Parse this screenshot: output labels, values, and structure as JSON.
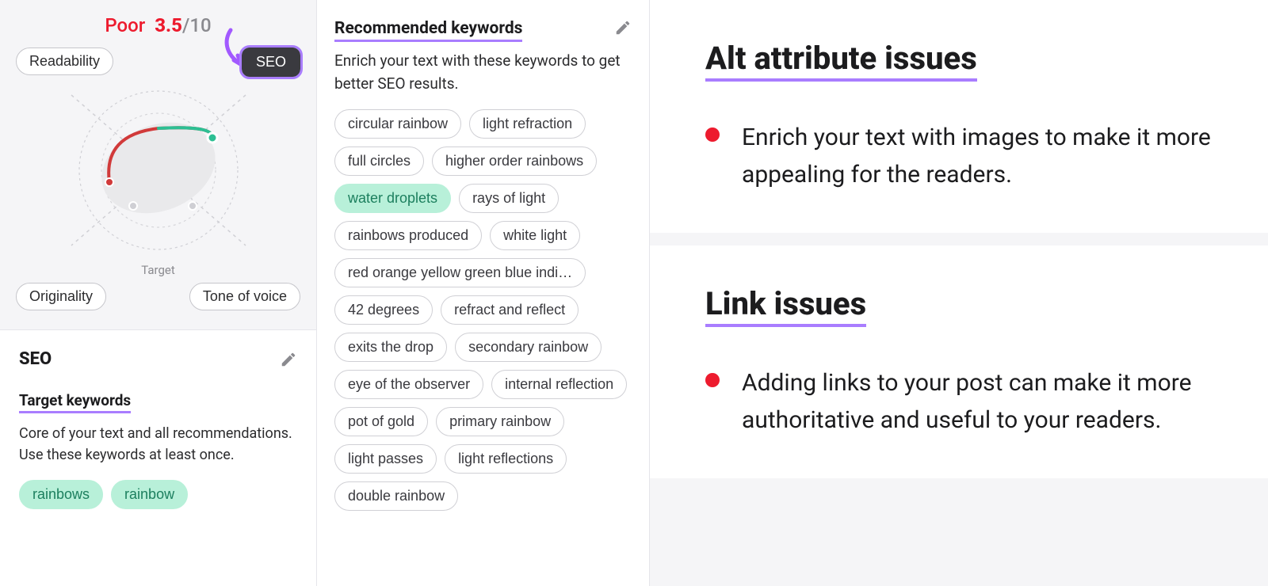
{
  "score": {
    "label": "Poor",
    "value": "3.5",
    "out_of": "/10"
  },
  "axes": {
    "readability": "Readability",
    "seo": "SEO",
    "originality": "Originality",
    "tone": "Tone of voice",
    "target_label": "Target"
  },
  "seo_card": {
    "title": "SEO",
    "section_title": "Target keywords",
    "desc": "Core of your text and all recommendations. Use these keywords at least once.",
    "keywords": [
      "rainbows",
      "rainbow"
    ]
  },
  "recommended": {
    "title": "Recommended keywords",
    "desc": "Enrich your text with these keywords to get better SEO results.",
    "keywords": [
      {
        "text": "circular rainbow",
        "hl": false
      },
      {
        "text": "light refraction",
        "hl": false
      },
      {
        "text": "full circles",
        "hl": false
      },
      {
        "text": "higher order rainbows",
        "hl": false
      },
      {
        "text": "water droplets",
        "hl": true
      },
      {
        "text": "rays of light",
        "hl": false
      },
      {
        "text": "rainbows produced",
        "hl": false
      },
      {
        "text": "white light",
        "hl": false
      },
      {
        "text": "red orange yellow green blue indi…",
        "hl": false
      },
      {
        "text": "42 degrees",
        "hl": false
      },
      {
        "text": "refract and reflect",
        "hl": false
      },
      {
        "text": "exits the drop",
        "hl": false
      },
      {
        "text": "secondary rainbow",
        "hl": false
      },
      {
        "text": "eye of the observer",
        "hl": false
      },
      {
        "text": "internal reflection",
        "hl": false
      },
      {
        "text": "pot of gold",
        "hl": false
      },
      {
        "text": "primary rainbow",
        "hl": false
      },
      {
        "text": "light passes",
        "hl": false
      },
      {
        "text": "light reflections",
        "hl": false
      },
      {
        "text": "double rainbow",
        "hl": false
      }
    ]
  },
  "issues": [
    {
      "title": "Alt attribute issues",
      "text": "Enrich your text with images to make it more appealing for the readers."
    },
    {
      "title": "Link issues",
      "text": "Adding links to your post can make it more authoritative and useful to your readers."
    }
  ]
}
